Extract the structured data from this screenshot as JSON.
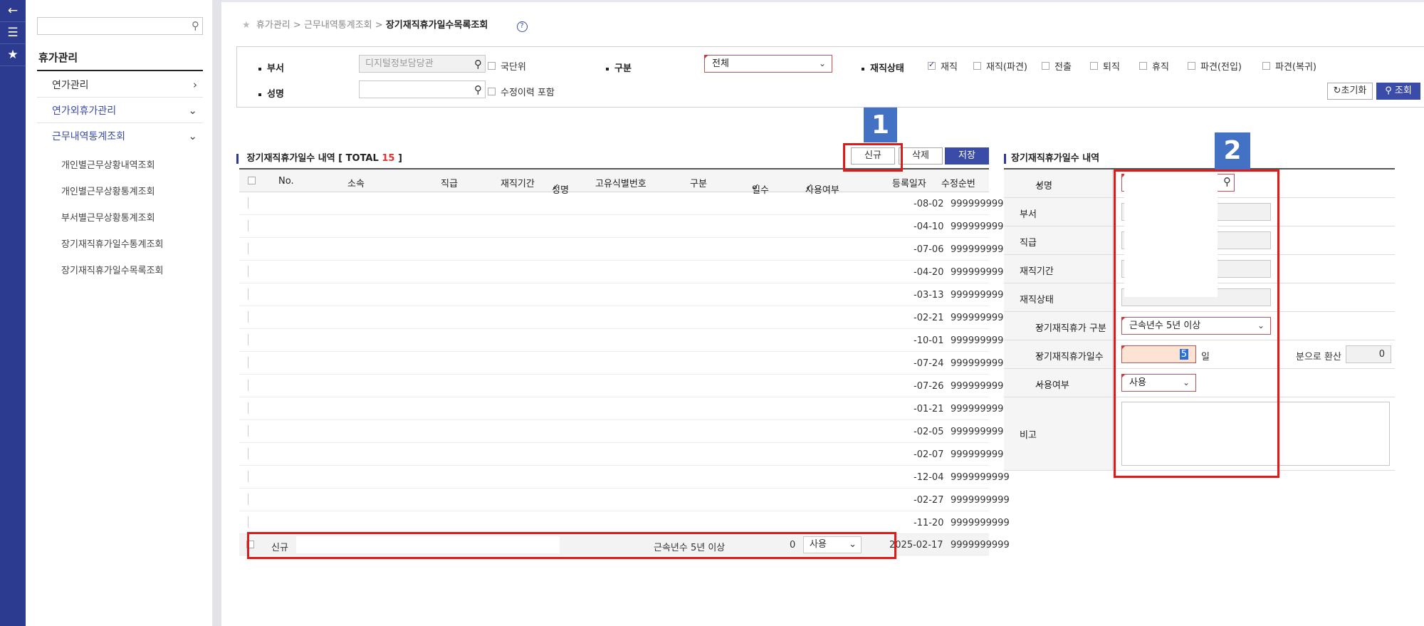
{
  "rail": {
    "icons": [
      "back-arrow-icon",
      "list-icon",
      "star-icon"
    ]
  },
  "sidebar": {
    "search_placeholder": "",
    "title": "휴가관리",
    "menu": [
      {
        "label": "연가관리",
        "chevron": "right"
      },
      {
        "label": "연가외휴가관리",
        "chevron": "down"
      },
      {
        "label": "근무내역통계조회",
        "chevron": "down"
      }
    ],
    "submenu": [
      "개인별근무상황내역조회",
      "개인별근무상황통계조회",
      "부서별근무상황통계조회",
      "장기재직휴가일수통계조회",
      "장기재직휴가일수목록조회"
    ]
  },
  "breadcrumb": {
    "part1": "휴가관리",
    "sep": ">",
    "part2": "근무내역통계조회",
    "current": "장기재직휴가일수목록조회"
  },
  "search": {
    "dept_label": "부서",
    "dept_value": "디지털정보담당관",
    "national_label": "국단위",
    "gubun_label": "구분",
    "gubun_value": "전체",
    "status_label": "재직상태",
    "status_options": [
      {
        "label": "재직",
        "checked": true
      },
      {
        "label": "재직(파견)",
        "checked": false
      },
      {
        "label": "전출",
        "checked": false
      },
      {
        "label": "퇴직",
        "checked": false
      },
      {
        "label": "휴직",
        "checked": false
      },
      {
        "label": "파견(전입)",
        "checked": false
      },
      {
        "label": "파견(복귀)",
        "checked": false
      }
    ],
    "name_label": "성명",
    "name_value": "",
    "history_label": "수정이력 포함",
    "reset_label": "초기화",
    "search_label": "조회"
  },
  "list": {
    "title": "장기재직휴가일수 내역 [ TOTAL",
    "total": "15",
    "title_end": "]",
    "new_label": "신규",
    "delete_label": "삭제",
    "save_label": "저장",
    "headers": [
      "No.",
      "소속",
      "직급",
      "재직기간",
      "성명",
      "고유식별번호",
      "구분",
      "일수",
      "사용여부",
      "등록일자",
      "수정순번"
    ],
    "rows": [
      {
        "date": "-08-02",
        "seq": "9999999999"
      },
      {
        "date": "-04-10",
        "seq": "9999999999"
      },
      {
        "date": "-07-06",
        "seq": "9999999999"
      },
      {
        "date": "-04-20",
        "seq": "9999999999"
      },
      {
        "date": "-03-13",
        "seq": "9999999999"
      },
      {
        "date": "-02-21",
        "seq": "9999999999"
      },
      {
        "date": "-10-01",
        "seq": "9999999999"
      },
      {
        "date": "-07-24",
        "seq": "9999999999"
      },
      {
        "date": "-07-26",
        "seq": "9999999999"
      },
      {
        "date": "-01-21",
        "seq": "9999999999"
      },
      {
        "date": "-02-05",
        "seq": "9999999999"
      },
      {
        "date": "-02-07",
        "seq": "9999999999"
      },
      {
        "date": "-12-04",
        "seq": "9999999999"
      },
      {
        "date": "-02-27",
        "seq": "9999999999"
      },
      {
        "date": "-11-20",
        "seq": "9999999999"
      }
    ],
    "new_row": {
      "no": "신규",
      "gubun": "근속년수 5년 이상",
      "days": "0",
      "use": "사용",
      "date": "2025-02-17",
      "seq": "9999999999"
    }
  },
  "detail": {
    "title": "장기재직휴가일수 내역",
    "name_label": "성명",
    "dept_label": "부서",
    "rank_label": "직급",
    "period_label": "재직기간",
    "status_label": "재직상태",
    "type_label": "장기재직휴가 구분",
    "type_value": "근속년수 5년 이상",
    "days_label": "장기재직휴가일수",
    "days_value": "5",
    "days_unit": "일",
    "convert_label": "분으로 환산",
    "convert_value": "0",
    "use_label": "사용여부",
    "use_value": "사용",
    "note_label": "비고"
  },
  "annotations": {
    "badge1": "1",
    "badge2": "2"
  },
  "colors": {
    "accent": "#3a4ba8",
    "rail": "#2c3a8f",
    "highlight": "#e01919",
    "badge": "#4372c4"
  }
}
